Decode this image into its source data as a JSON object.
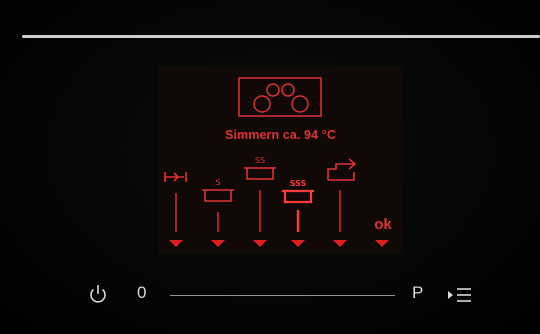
{
  "display": {
    "status_text": "Simmern ca. 94 °C",
    "ok_label": "ok"
  },
  "icons": {
    "hob": "cooktop-icon",
    "columns": [
      "boost-icon",
      "simmer-level-1-icon",
      "simmer-level-2-icon",
      "simmer-level-3-icon",
      "pan-lid-icon",
      "confirm-ok"
    ]
  },
  "controls": {
    "power": "power-icon",
    "zero_label": "0",
    "p_label": "P",
    "menu": "menu-play-icon"
  },
  "colors": {
    "accent_red": "#e03232",
    "arrow_red": "#e02020",
    "text_white": "#d8d8d8",
    "line_grey": "#cfcfcf",
    "background": "#000000"
  }
}
